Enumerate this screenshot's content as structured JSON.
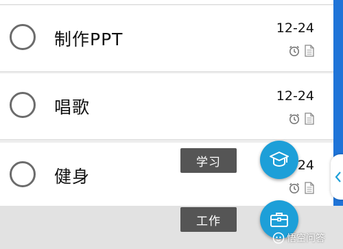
{
  "tasks": [
    {
      "title": "制作PPT",
      "date": "12-24",
      "icons": [
        "alarm-icon",
        "note-icon"
      ]
    },
    {
      "title": "唱歌",
      "date": "12-24",
      "icons": [
        "alarm-icon",
        "note-icon"
      ]
    },
    {
      "title": "健身",
      "date": "12-24",
      "icons": [
        "alarm-icon",
        "note-icon"
      ]
    }
  ],
  "fab_menu": [
    {
      "label": "学习",
      "icon": "graduation-cap-icon"
    },
    {
      "label": "工作",
      "icon": "briefcase-icon"
    }
  ],
  "watermark": {
    "text": "悟空问答",
    "icon": "logo-icon"
  },
  "colors": {
    "accent": "#1d9fd8",
    "sidebar": "#1f74d8",
    "label_bg": "#555555"
  }
}
